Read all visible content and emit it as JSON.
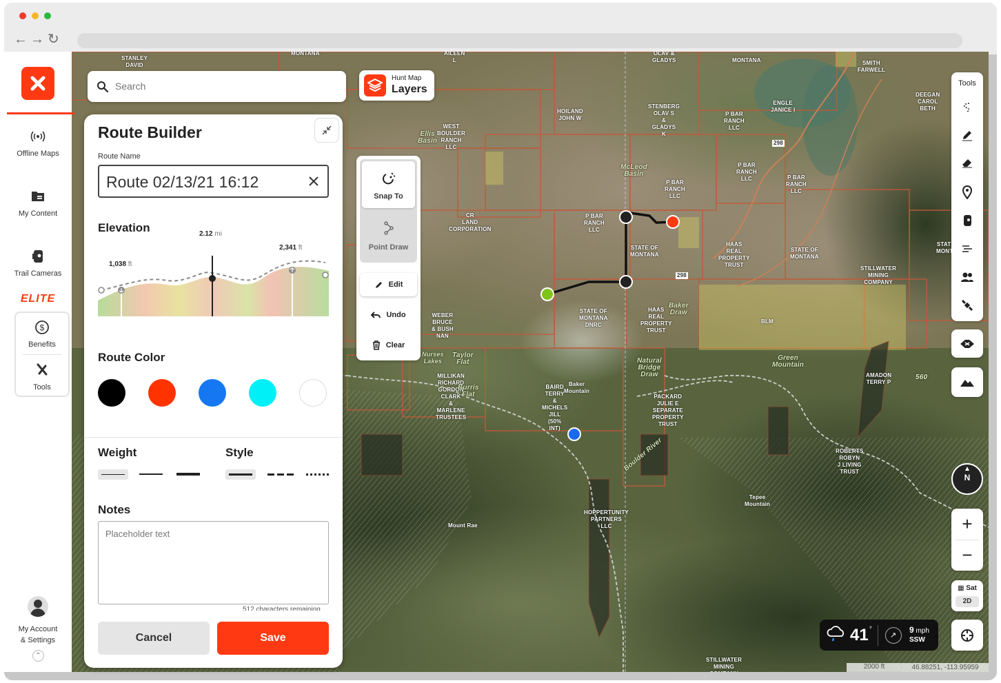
{
  "sidebar": {
    "offline_maps": "Offline Maps",
    "my_content": "My Content",
    "trail_cameras": "Trail Cameras",
    "elite": "ELITE",
    "benefits": "Benefits",
    "tools": "Tools",
    "account_line1": "My Account",
    "account_line2": "& Settings"
  },
  "search": {
    "placeholder": "Search"
  },
  "layers": {
    "small": "Hunt Map",
    "big": "Layers"
  },
  "route_builder": {
    "title": "Route Builder",
    "route_name_label": "Route Name",
    "route_name_value": "Route 02/13/21 16:12",
    "elevation_title": "Elevation",
    "elev_min_value": "1,038",
    "elev_min_unit": "ft",
    "elev_cursor_value": "2.12",
    "elev_cursor_unit": "mi",
    "elev_max_value": "2,341",
    "elev_max_unit": "ft",
    "route_color_title": "Route Color",
    "colors": [
      "#000000",
      "#ff3300",
      "#1677f2",
      "#00f0f8",
      "#ffffff"
    ],
    "weight_title": "Weight",
    "style_title": "Style",
    "notes_title": "Notes",
    "notes_placeholder": "Placeholder text",
    "chars_remaining": "512 characters remaining",
    "cancel": "Cancel",
    "save": "Save"
  },
  "draw_tools": {
    "snap_to": "Snap To",
    "point_draw": "Point Draw",
    "edit": "Edit",
    "undo": "Undo",
    "clear": "Clear"
  },
  "right_tools": {
    "title": "Tools",
    "icons": [
      "lasso-icon",
      "pen-icon",
      "eraser-icon",
      "map-pin-icon",
      "trail-camera-icon",
      "wind-icon",
      "people-icon",
      "satellite-icon"
    ]
  },
  "compass": {
    "label": "N"
  },
  "map_mode": {
    "type": "Sat",
    "dim": "2D"
  },
  "weather": {
    "temp": "41",
    "wind_speed": "9",
    "wind_unit": "mph",
    "wind_dir": "SSW"
  },
  "scale": {
    "label": "2000 ft"
  },
  "coords": "46.88251, -113.95959",
  "map_labels": [
    {
      "t": "STANLEY\nDAVID"
    },
    {
      "t": "MONTANA"
    },
    {
      "t": "AILEEN\nL"
    },
    {
      "t": "OLAV &\nGLADYS"
    },
    {
      "t": "MONTANA"
    },
    {
      "t": "SMITH\nFARWELL"
    },
    {
      "t": "DEEGAN\nCAROL\nBETH"
    },
    {
      "t": "HOILAND\nJOHN W"
    },
    {
      "t": "STENBERG\nOLAV S\n&\nGLADYS\nK"
    },
    {
      "t": "P BAR\nRANCH\nLLC"
    },
    {
      "t": "ENGLE\nJANICE I"
    },
    {
      "t": "WEST\nBOULDER\nRANCH\nLLC"
    },
    {
      "t": "Ellis\nBasin"
    },
    {
      "t": "McLeod\nBasin"
    },
    {
      "t": "P BAR\nRANCH\nLLC"
    },
    {
      "t": "P BAR\nRANCH\nLLC"
    },
    {
      "t": "P BAR\nRANCH\nLLC"
    },
    {
      "t": "CR\nLAND\nCORPORATION"
    },
    {
      "t": "P BAR\nRANCH\nLLC"
    },
    {
      "t": "STATE OF\nMONTANA"
    },
    {
      "t": "HAAS\nREAL\nPROPERTY\nTRUST"
    },
    {
      "t": "STATE OF\nMONTANA"
    },
    {
      "t": "STATE OF\nMONTANA"
    },
    {
      "t": "STILLWATER\nMINING\nCOMPANY"
    },
    {
      "t": "STATE OF\nMONTANA\nDNRC"
    },
    {
      "t": "HAAS\nREAL\nPROPERTY\nTRUST"
    },
    {
      "t": "Baker\nDraw"
    },
    {
      "t": "BLM"
    },
    {
      "t": "WEBER\nBRUCE\n& BUSH\nNAN"
    },
    {
      "t": "Nurses\nLakes"
    },
    {
      "t": "Taylor\nFlat"
    },
    {
      "t": "Green\nMountain"
    },
    {
      "t": "AMADON\nTERRY P"
    },
    {
      "t": "MILLIKAN\nRICHARD\nGORDON\nCLARK\n&\nMARLENE\nTRUSTEES"
    },
    {
      "t": "Burris\nFlat"
    },
    {
      "t": "BAIRD\nTERRY\n&\nMICHELS\nJILL\n(50%\nINT)"
    },
    {
      "t": "Baker\nMountain"
    },
    {
      "t": "Natural\nBridge\nDraw"
    },
    {
      "t": "PACKARD\nJULIE E\nSEPARATE\nPROPERTY\nTRUST"
    },
    {
      "t": "Boulder River"
    },
    {
      "t": "ROBERTS\nROBYN\nJ LIVING\nTRUST"
    },
    {
      "t": "Tepee\nMountain"
    },
    {
      "t": "Mount Rae"
    },
    {
      "t": "HOPPERTUNITY\nPARTNERS\nLLC"
    },
    {
      "t": "STILLWATER\nMINING\nCOMPANY"
    },
    {
      "t": "560"
    },
    {
      "t": "298"
    },
    {
      "t": "298"
    }
  ]
}
